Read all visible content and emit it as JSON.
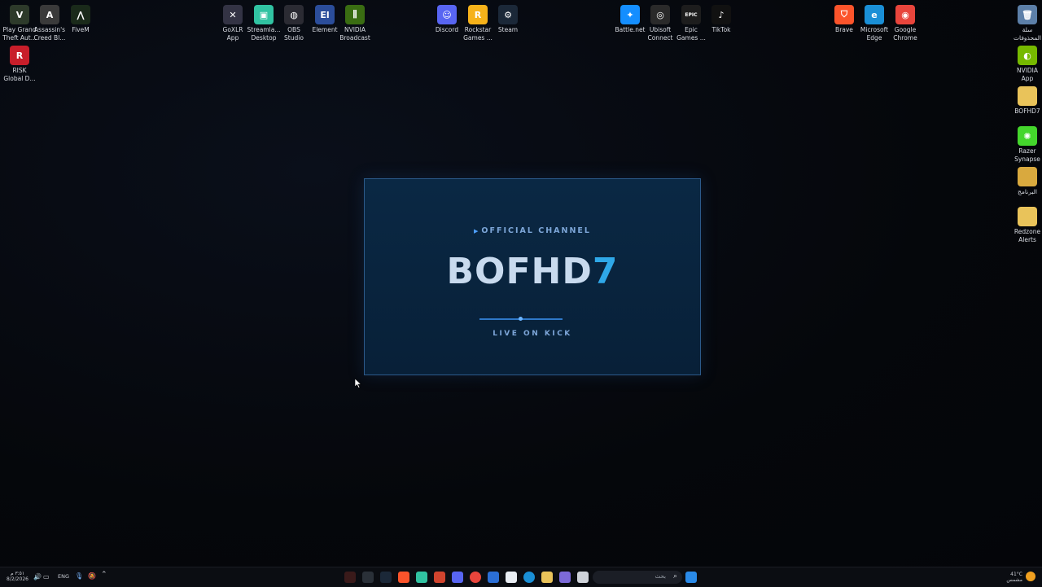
{
  "desktop": {
    "icons": [
      {
        "label": "Play Grand\nTheft Aut...",
        "icon": "gta-v-icon",
        "color": "#2d3a2a",
        "glyph": "V"
      },
      {
        "label": "Assassin's\nCreed Bl...",
        "icon": "assassins-creed-icon",
        "color": "#3a3a3a",
        "glyph": "A"
      },
      {
        "label": "FiveM",
        "icon": "fivem-icon",
        "color": "#1a2a1a",
        "glyph": "⋀"
      },
      {
        "label": "RISK\nGlobal D...",
        "icon": "risk-icon",
        "color": "#c81e2a",
        "glyph": "R"
      },
      {
        "label": "GoXLR\nApp",
        "icon": "goxlr-icon",
        "color": "#334",
        "glyph": "✕"
      },
      {
        "label": "Streamla...\nDesktop",
        "icon": "streamlabs-icon",
        "color": "#31c3a2",
        "glyph": "▣"
      },
      {
        "label": "OBS\nStudio",
        "icon": "obs-icon",
        "color": "#2b2b33",
        "glyph": "◍"
      },
      {
        "label": "Element",
        "icon": "element-icon",
        "color": "#2b4d9a",
        "glyph": "El"
      },
      {
        "label": "NVIDIA\nBroadcast",
        "icon": "nvidia-broadcast-icon",
        "color": "#3a6d12",
        "glyph": "⫼"
      },
      {
        "label": "Discord",
        "icon": "discord-icon",
        "color": "#5865f2",
        "glyph": "☺"
      },
      {
        "label": "Rockstar\nGames ...",
        "icon": "rockstar-icon",
        "color": "#f6b21a",
        "glyph": "R"
      },
      {
        "label": "Steam",
        "icon": "steam-icon",
        "color": "#1b2838",
        "glyph": "⚙"
      },
      {
        "label": "Battle.net",
        "icon": "battlenet-icon",
        "color": "#148eff",
        "glyph": "✦"
      },
      {
        "label": "Ubisoft\nConnect",
        "icon": "ubisoft-icon",
        "color": "#2a2a2a",
        "glyph": "◎"
      },
      {
        "label": "Epic\nGames ...",
        "icon": "epic-games-icon",
        "color": "#1d1d1d",
        "glyph": "EPIC"
      },
      {
        "label": "TikTok",
        "icon": "tiktok-icon",
        "color": "#111",
        "glyph": "♪"
      },
      {
        "label": "Brave",
        "icon": "brave-icon",
        "color": "#fb542b",
        "glyph": "⛉"
      },
      {
        "label": "Microsoft\nEdge",
        "icon": "edge-icon",
        "color": "#1a8fd6",
        "glyph": "e"
      },
      {
        "label": "Google\nChrome",
        "icon": "chrome-icon",
        "color": "#e8453c",
        "glyph": "◉"
      },
      {
        "label": "سلة\nالمحذوفات",
        "icon": "recycle-bin-icon",
        "color": "#5c7fa8",
        "glyph": "🗑"
      },
      {
        "label": "NVIDIA\nApp",
        "icon": "nvidia-app-icon",
        "color": "#76b900",
        "glyph": "◐"
      },
      {
        "label": "BOFHD7",
        "icon": "folder-icon",
        "color": "#e9c35a",
        "glyph": ""
      },
      {
        "label": "Razer\nSynapse",
        "icon": "razer-icon",
        "color": "#44d62c",
        "glyph": "✺"
      },
      {
        "label": "البرنامج",
        "icon": "folder-icon",
        "color": "#d9a93e",
        "glyph": ""
      },
      {
        "label": "Redzone\nAlerts",
        "icon": "folder-icon",
        "color": "#e9c35a",
        "glyph": ""
      }
    ]
  },
  "banner": {
    "kicker": "OFFICIAL CHANNEL",
    "title_main": "BOFHD",
    "title_accent": "7",
    "subtitle": "LIVE ON KICK"
  },
  "taskbar": {
    "time": "٣:٥١ م",
    "date": "8/2/2026",
    "language": "ENG",
    "search_placeholder": "بحث",
    "weather_temp": "41°C",
    "weather_text": "مشمس"
  }
}
